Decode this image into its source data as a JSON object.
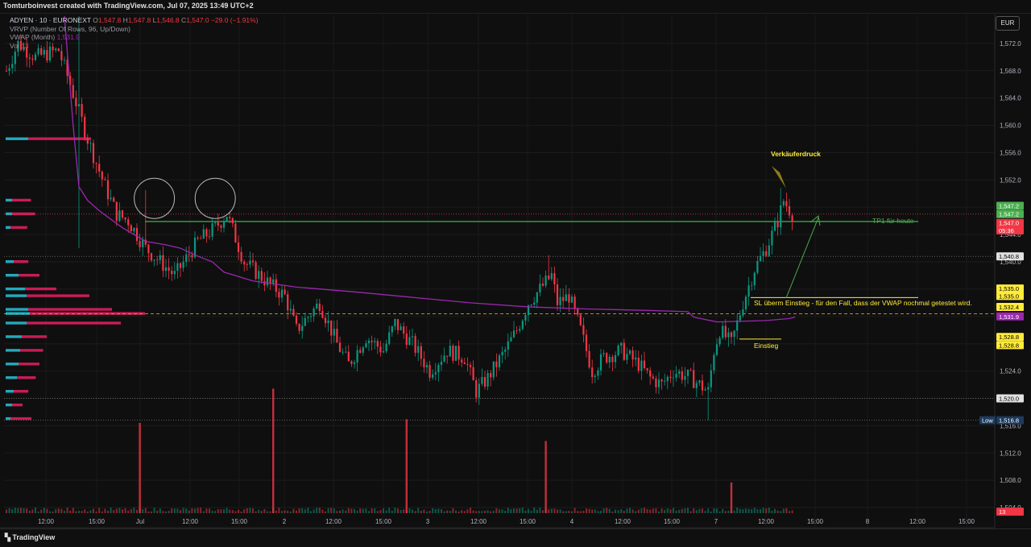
{
  "header": {
    "attribution": "Tomturboinvest created with TradingView.com, Jul 07, 2025 13:49 UTC+2"
  },
  "legend": {
    "symbol": "ADYEN · 10 · EURONEXT",
    "o_label": "O",
    "o": "1,547.8",
    "h_label": "H",
    "h": "1,547.8",
    "l_label": "L",
    "l": "1,546.8",
    "c_label": "C",
    "c": "1,547.0",
    "change": "−29.0 (−1.91%)",
    "vrvp": "VRVP (Number Of Rows, 96, Up/Down)",
    "vwap": "VWAP (Month)",
    "vwap_value": "1,531.9",
    "vol": "Vol",
    "vol_value": "13"
  },
  "currency": "EUR",
  "footer": {
    "brand": "TradingView"
  },
  "colors": {
    "up": "#089981",
    "down": "#f23645",
    "vwap": "#9c27b0",
    "profile_up": "#26c6da",
    "profile_down": "#e91e63",
    "tp_line": "#4caf50",
    "annotation": "#ffeb3b"
  },
  "chart_data": {
    "type": "candlestick",
    "y_axis": {
      "min": 1502,
      "max": 1576,
      "ticks": [
        "1,572.0",
        "1,568.0",
        "1,564.0",
        "1,560.0",
        "1,556.0",
        "1,552.0",
        "1,548.0",
        "1,544.0",
        "1,540.0",
        "1,536.0",
        "1,532.0",
        "1,528.0",
        "1,524.0",
        "1,520.0",
        "1,516.0",
        "1,512.0",
        "1,508.0",
        "1,504.0"
      ]
    },
    "x_axis": {
      "ticks": [
        "12:00",
        "15:00",
        "Jul",
        "12:00",
        "15:00",
        "2",
        "12:00",
        "15:00",
        "3",
        "12:00",
        "15:00",
        "4",
        "12:00",
        "15:00",
        "7",
        "12:00",
        "15:00",
        "8",
        "12:00",
        "15:00"
      ]
    },
    "price_labels": [
      {
        "text": "1,547.2",
        "value": 1548.2,
        "color": "#4caf50"
      },
      {
        "text": "1,547.2",
        "value": 1547.0,
        "color": "#4caf50"
      },
      {
        "text": "1,547.0",
        "value": 1545.7,
        "color": "#f23645"
      },
      {
        "text": "05:36",
        "value": 1544.6,
        "color": "#f23645"
      },
      {
        "text": "1,540.8",
        "value": 1540.8,
        "color": "#e0e0e0"
      },
      {
        "text": "1,535.0",
        "value": 1536.1,
        "color": "#ffeb3b"
      },
      {
        "text": "1,535.0",
        "value": 1535.0,
        "color": "#ffeb3b"
      },
      {
        "text": "1,532.4",
        "value": 1533.4,
        "color": "#ffeb3b"
      },
      {
        "text": "1,531.9",
        "value": 1532.0,
        "color": "#9c27b0"
      },
      {
        "text": "1,528.8",
        "value": 1529.0,
        "color": "#ffeb3b"
      },
      {
        "text": "1,528.8",
        "value": 1527.8,
        "color": "#ffeb3b"
      },
      {
        "text": "1,520.0",
        "value": 1520.0,
        "color": "#e0e0e0"
      },
      {
        "text": "1,516.8",
        "value": 1516.8,
        "color": "#1e3a5f"
      },
      {
        "text": "13",
        "value": 1503.4,
        "color": "#f23645"
      }
    ],
    "low_label": "Low",
    "annotations": {
      "seller_pressure": "Verkäuferdruck",
      "tp1": "TP1 für heute",
      "sl": "SL überm Einstieg - für den Fall, dass der VWAP nochmal getestet wird.",
      "entry": "Einstieg"
    },
    "levels": {
      "tp1": 1545.9,
      "poc": 1532.4,
      "sl": 1535.0,
      "entry": 1528.8,
      "last": 1547.0,
      "low": 1516.8,
      "line_1540": 1540.8,
      "line_1520": 1520.0
    },
    "vwap_path": [
      [
        1,
        null
      ],
      [
        20,
        1576
      ],
      [
        23,
        1560
      ],
      [
        25,
        1551
      ],
      [
        28,
        1549
      ],
      [
        32,
        1547.5
      ],
      [
        40,
        1545
      ],
      [
        48,
        1543
      ],
      [
        55,
        1542.5
      ],
      [
        60,
        1542
      ],
      [
        65,
        1541
      ],
      [
        71,
        1540
      ],
      [
        75,
        1538.5
      ],
      [
        85,
        1537.2
      ],
      [
        100,
        1536.3
      ],
      [
        120,
        1535.6
      ],
      [
        140,
        1534.8
      ],
      [
        160,
        1534
      ],
      [
        180,
        1533.4
      ],
      [
        200,
        1533.1
      ],
      [
        220,
        1532.9
      ],
      [
        235,
        1532.7
      ],
      [
        237,
        1531.9
      ],
      [
        245,
        1531.2
      ],
      [
        262,
        1531.4
      ],
      [
        270,
        1531.7
      ],
      [
        272,
        1531.9
      ]
    ],
    "vol_spikes": [
      {
        "i": 25,
        "v": 1.0
      },
      {
        "i": 53,
        "v": 1.38
      },
      {
        "i": 80,
        "v": 1.04
      },
      {
        "i": 108,
        "v": 0.8
      },
      {
        "i": 135,
        "v": 0.34
      }
    ],
    "circles": [
      {
        "x_index": 26,
        "price": 1549.3
      },
      {
        "x_index": 47,
        "price": 1549.3
      }
    ]
  }
}
